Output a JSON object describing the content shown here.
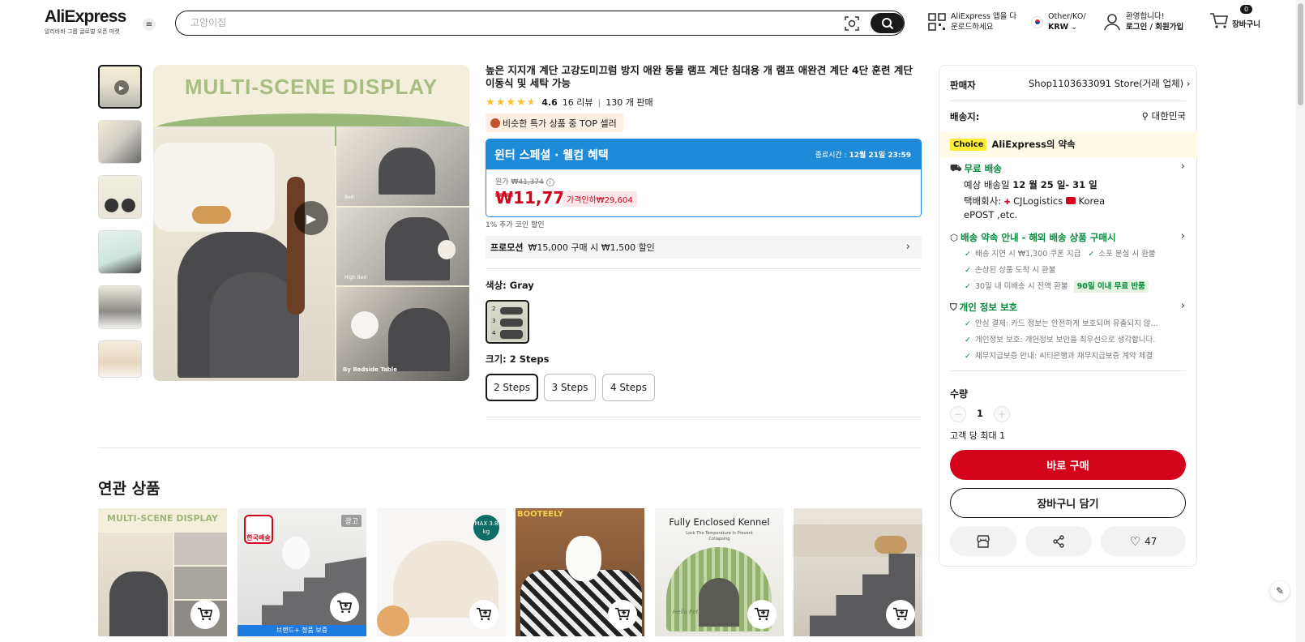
{
  "header": {
    "logo": "AliExpress",
    "logo_sub": "알리바바 그룹 글로벌 오픈 마켓",
    "search_placeholder": "고양이집",
    "app_line1": "AliExpress 앱을 다",
    "app_line2": "운로드하세요",
    "locale_line1": "Other/KO/",
    "locale_currency": "KRW",
    "welcome": "환영합니다!",
    "login": "로그인 / 회원가입",
    "cart_count": "0",
    "cart_label": "장바구니"
  },
  "product": {
    "title": "높은 지지개 계단 고강도미끄럼 방지 애완 동물 램프 계단 침대용 개 램프 애완견 계단 4단 훈련 계단 이동식 및 세탁 가능",
    "rating": "4.6",
    "reviews": "16 리뷰",
    "sold": "130 개 판매",
    "rating_value": 4.6,
    "top_seller_badge": "비슷한 특가 상품 중 TOP 셀러",
    "banner_title": "윈터 스페셜 · 웰컴 혜택",
    "end_label": "종료시간 :",
    "end_time": "12월 21일 23:59",
    "orig_label": "원가",
    "orig_price": "₩41,374",
    "price": "₩11,770",
    "discount": "가격인하₩29,604",
    "coin": "1% 추가 코인 할인",
    "promo_label": "프로모션",
    "promo_text": "₩15,000 구매 시 ₩1,500 할인",
    "color_label": "색상: Gray",
    "size_label": "크기: 2 Steps",
    "sizes": [
      "2 Steps",
      "3 Steps",
      "4 Steps"
    ],
    "gallery_heading": "MULTI-SCENE DISPLAY",
    "gallery_cap1": "Bed",
    "gallery_cap2": "High Bed",
    "gallery_cap3": "By Bedside Table",
    "color_swatch_steps": [
      "2",
      "3",
      "4"
    ]
  },
  "related": {
    "title": "연관 상품",
    "cards": [
      {
        "label": "MULTI-SCENE DISPLAY"
      },
      {
        "label": "한국배송",
        "ad": "광고",
        "footer": "브랜드+ 정품 보증"
      },
      {
        "label": "MAX 3.8",
        "unit": "kg"
      },
      {
        "label": "BOOTEELY"
      },
      {
        "label": "Fully Enclosed Kennel",
        "sub": "Lock The Temperature In Prevent Collapsing",
        "brand": "Hello Pets"
      },
      {
        "label": ""
      }
    ]
  },
  "side": {
    "seller_label": "판매자",
    "seller_value": "Shop1103633091 Store(거래 업체)",
    "ship_label": "배송지:",
    "ship_value": "대한민국",
    "choice_badge": "Choice",
    "choice_text": "AliExpress의 약속",
    "free_ship": "무료 배송",
    "eta_prefix": "예상 배송일",
    "eta_date": "12 월 25 일- 31 일",
    "carrier_prefix": "택배회사:",
    "carrier1": "CJLogistics",
    "carrier2": "Korea",
    "carrier2b": "ePOST ,etc.",
    "promise_title": "배송 약속 안내 - 해외 배송 상품 구매시",
    "promise_items": [
      "배송 지연 시 ₩1,300 쿠폰 지급",
      "소포 분실 시 환불",
      "손상된 상품 도착 시 환불",
      "30일 내 미배송 시 전액 환불"
    ],
    "return_badge": "90일 이내 무료 반품",
    "privacy_title": "개인 정보 보호",
    "privacy_items": [
      "안심 결제: 카드 정보는 안전하게 보호되며 유출되지 않...",
      "개인정보 보호: 개인정보 보안을 최우선으로 생각합니다.",
      "채무지급보증 안내: 씨티은행과 채무지급보증 계약 체결"
    ],
    "qty_label": "수량",
    "qty_value": "1",
    "qty_minus": "−",
    "qty_plus": "+",
    "limit": "고객 당 최대 1",
    "buy": "바로 구매",
    "add_cart": "장바구니 담기",
    "likes": "47"
  },
  "colors": {
    "accent": "#d3031c",
    "blue": "#1f8bd8",
    "green": "#008a39"
  }
}
